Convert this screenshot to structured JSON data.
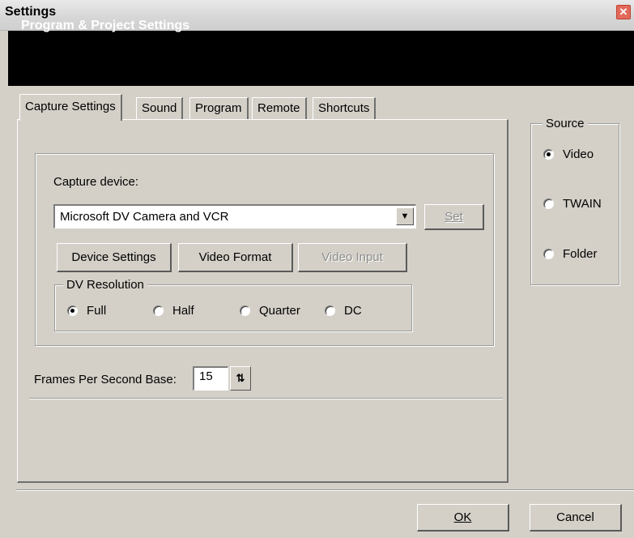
{
  "window": {
    "title": "Settings",
    "close_icon": "close-icon"
  },
  "header": {
    "title": "Program & Project Settings"
  },
  "tabs": [
    {
      "label": "Capture Settings",
      "active": true
    },
    {
      "label": "Sound",
      "active": false
    },
    {
      "label": "Program",
      "active": false
    },
    {
      "label": "Remote",
      "active": false
    },
    {
      "label": "Shortcuts",
      "active": false
    }
  ],
  "capture": {
    "device_label": "Capture device:",
    "device_value": "Microsoft DV Camera and VCR",
    "dropdown_icon": "chevron-down-icon",
    "set_label": "Set",
    "set_enabled": false,
    "device_settings_label": "Device Settings",
    "video_format_label": "Video Format",
    "video_input_label": "Video Input",
    "video_input_enabled": false,
    "dv_resolution": {
      "legend": "DV Resolution",
      "options": [
        "Full",
        "Half",
        "Quarter",
        "DC"
      ],
      "selected": "Full"
    }
  },
  "fps": {
    "label": "Frames Per Second Base:",
    "value": "15",
    "spin_icon": "spin-arrows-icon"
  },
  "source": {
    "legend": "Source",
    "options": [
      "Video",
      "TWAIN",
      "Folder"
    ],
    "selected": "Video"
  },
  "footer": {
    "ok_label": "OK",
    "cancel_label": "Cancel"
  },
  "colors": {
    "dialog_bg": "#d4d0c8",
    "header_bg": "#000000",
    "close_red": "#e26a5a"
  }
}
